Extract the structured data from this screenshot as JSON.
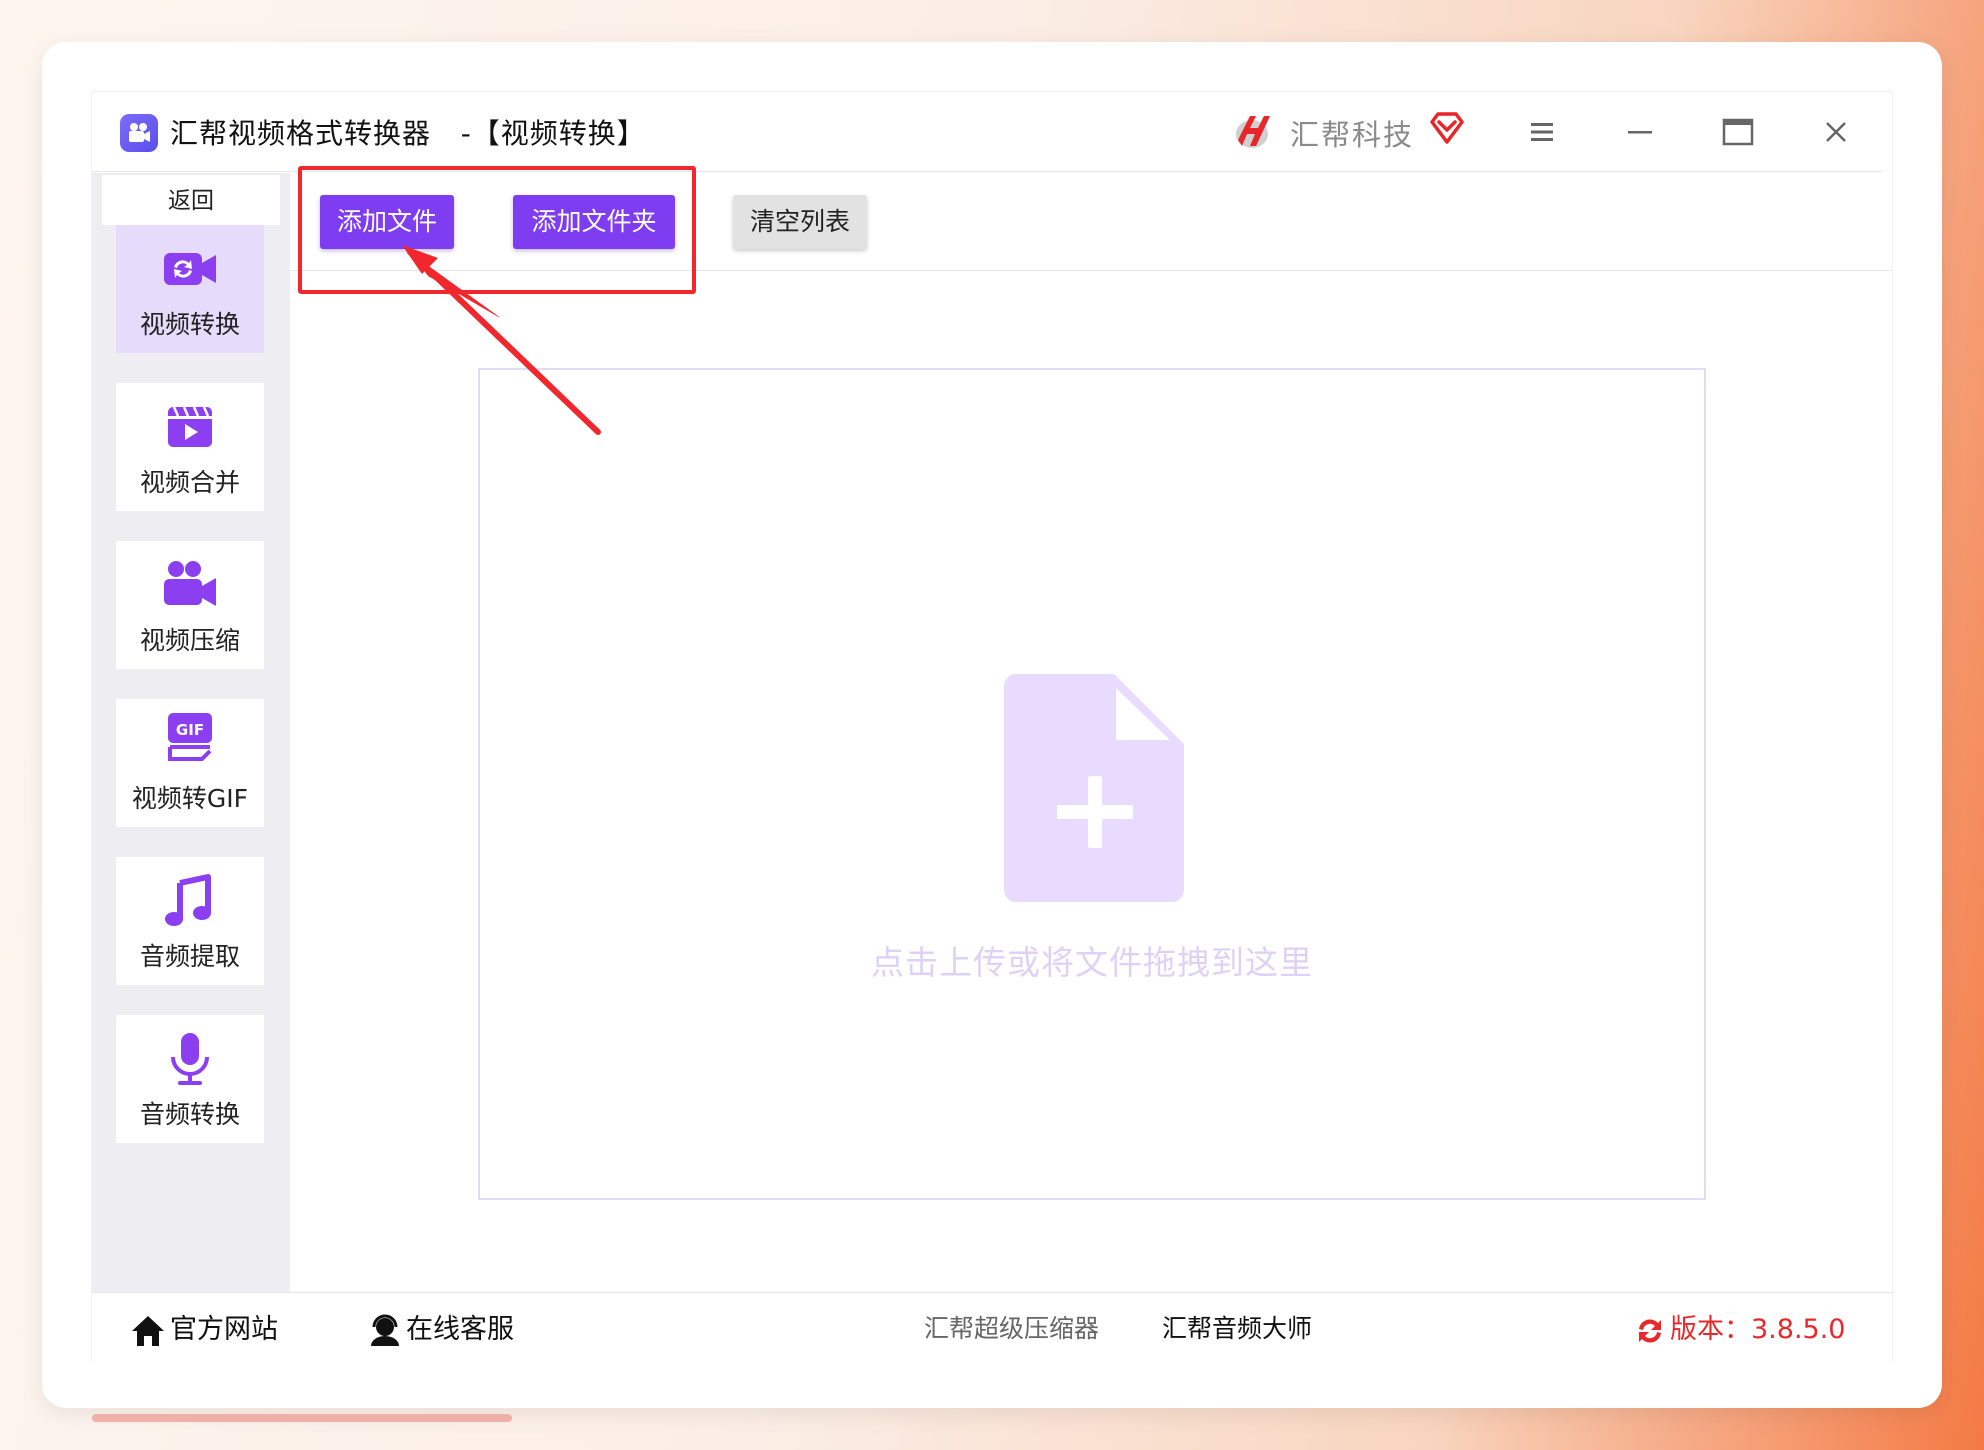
{
  "window": {
    "title": "汇帮视频格式转换器   -【视频转换】",
    "brand_name": "汇帮科技"
  },
  "sidebar": {
    "back_label": "返回",
    "items": [
      {
        "label": "视频转换",
        "icon": "video-convert-icon",
        "active": true
      },
      {
        "label": "视频合并",
        "icon": "video-merge-icon",
        "active": false
      },
      {
        "label": "视频压缩",
        "icon": "video-compress-icon",
        "active": false
      },
      {
        "label": "视频转GIF",
        "icon": "gif-icon",
        "active": false
      },
      {
        "label": "音频提取",
        "icon": "music-note-icon",
        "active": false
      },
      {
        "label": "音频转换",
        "icon": "microphone-icon",
        "active": false
      }
    ]
  },
  "toolbar": {
    "add_file_label": "添加文件",
    "add_folder_label": "添加文件夹",
    "clear_list_label": "清空列表"
  },
  "dropzone": {
    "hint": "点击上传或将文件拖拽到这里"
  },
  "footer": {
    "home_label": "官方网站",
    "service_label": "在线客服",
    "compressor_label": "汇帮超级压缩器",
    "audio_master_label": "汇帮音频大师",
    "version_label": "版本：3.8.5.0"
  },
  "colors": {
    "accent": "#7e3df0",
    "highlight": "#f0272c",
    "version": "#e8282b"
  }
}
